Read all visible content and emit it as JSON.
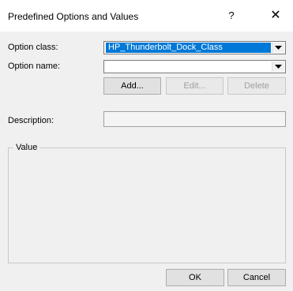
{
  "window": {
    "title": "Predefined Options and Values",
    "help_glyph": "?",
    "close_glyph": "✕"
  },
  "form": {
    "option_class": {
      "label": "Option class:",
      "value": "HP_Thunderbolt_Dock_Class"
    },
    "option_name": {
      "label": "Option name:",
      "value": ""
    },
    "buttons": {
      "add": "Add...",
      "edit": "Edit...",
      "delete": "Delete"
    },
    "description": {
      "label": "Description:",
      "value": ""
    },
    "value_group": {
      "label": "Value"
    }
  },
  "footer": {
    "ok": "OK",
    "cancel": "Cancel"
  },
  "colors": {
    "selection": "#0078d7",
    "dialog_bg": "#f0f0f0",
    "disabled_text": "#a0a0a0"
  },
  "icons": {
    "help": "question-mark-icon",
    "close": "close-icon",
    "dropdown": "chevron-down-icon"
  }
}
